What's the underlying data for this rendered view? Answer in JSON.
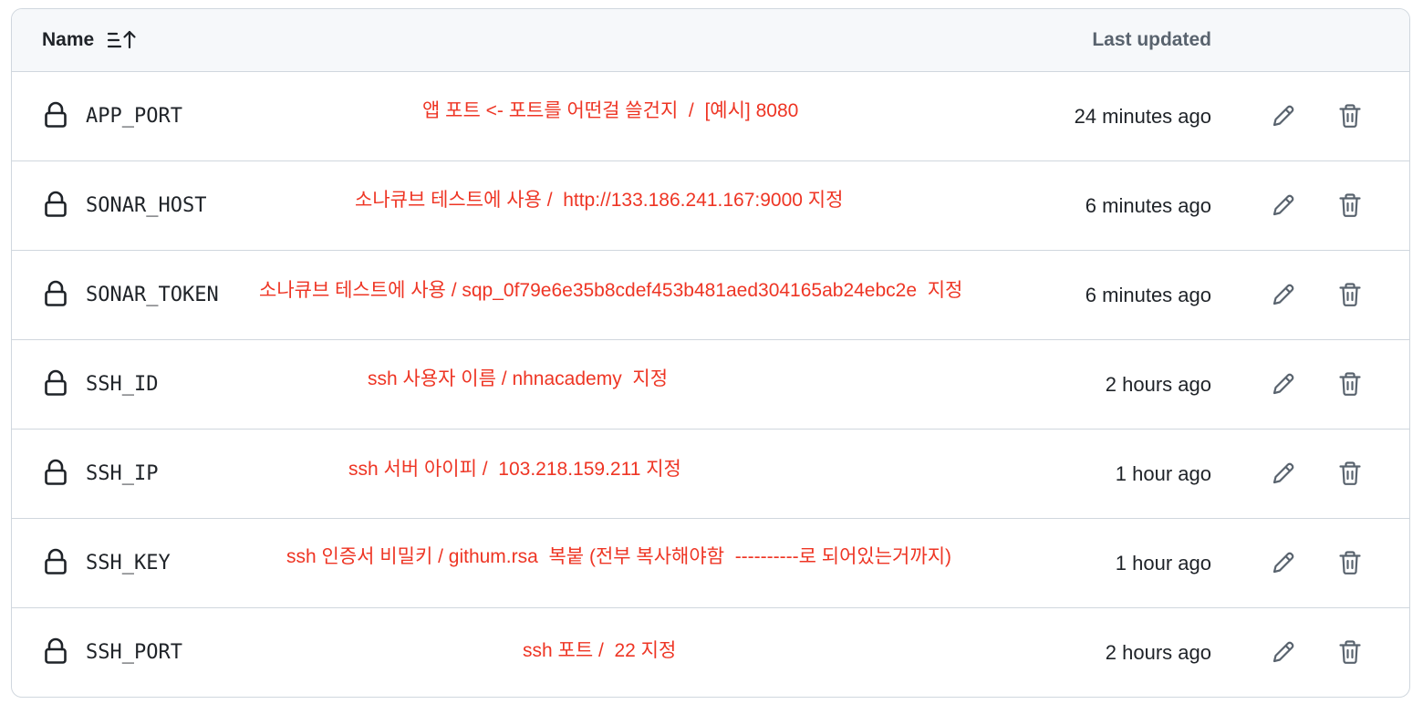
{
  "header": {
    "name_label": "Name",
    "updated_label": "Last updated",
    "sort_icon": "sort-ascending-icon"
  },
  "icons": {
    "lock": "lock-icon",
    "edit": "pencil-icon",
    "delete": "trash-icon"
  },
  "colors": {
    "note": "#ee3524",
    "border": "#d0d7de",
    "header_bg": "#f6f8fa",
    "muted": "#59636e"
  },
  "secrets": [
    {
      "name": "APP_PORT",
      "note": "앱 포트 <- 포트를 어떤걸 쓸건지  /  [예시] 8080",
      "updated": "24 minutes ago"
    },
    {
      "name": "SONAR_HOST",
      "note": "소나큐브 테스트에 사용 /  http://133.186.241.167:9000 지정",
      "updated": "6 minutes ago"
    },
    {
      "name": "SONAR_TOKEN",
      "note": "소나큐브 테스트에 사용 / sqp_0f79e6e35b8cdef453b481aed304165ab24ebc2e  지정",
      "updated": "6 minutes ago"
    },
    {
      "name": "SSH_ID",
      "note": "ssh 사용자 이름 / nhnacademy  지정",
      "updated": "2 hours ago"
    },
    {
      "name": "SSH_IP",
      "note": "ssh 서버 아이피 /  103.218.159.211 지정",
      "updated": "1 hour ago"
    },
    {
      "name": "SSH_KEY",
      "note": "ssh 인증서 비밀키 / githum.rsa  복붙 (전부 복사해야함  ----------로 되어있는거까지)",
      "updated": "1 hour ago"
    },
    {
      "name": "SSH_PORT",
      "note": "ssh 포트 /  22 지정",
      "updated": "2 hours ago"
    }
  ]
}
